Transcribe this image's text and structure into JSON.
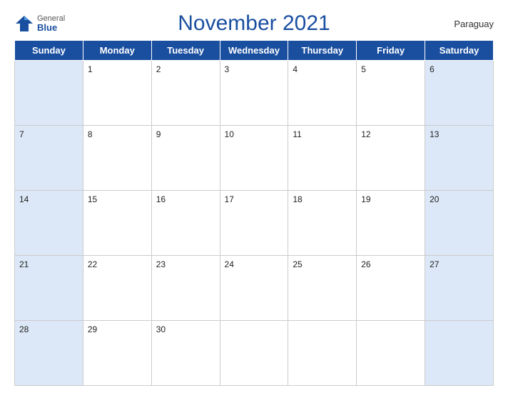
{
  "header": {
    "logo_general": "General",
    "logo_blue": "Blue",
    "title": "November 2021",
    "country": "Paraguay"
  },
  "weekdays": [
    "Sunday",
    "Monday",
    "Tuesday",
    "Wednesday",
    "Thursday",
    "Friday",
    "Saturday"
  ],
  "weeks": [
    [
      null,
      1,
      2,
      3,
      4,
      5,
      6
    ],
    [
      7,
      8,
      9,
      10,
      11,
      12,
      13
    ],
    [
      14,
      15,
      16,
      17,
      18,
      19,
      20
    ],
    [
      21,
      22,
      23,
      24,
      25,
      26,
      27
    ],
    [
      28,
      29,
      30,
      null,
      null,
      null,
      null
    ]
  ]
}
